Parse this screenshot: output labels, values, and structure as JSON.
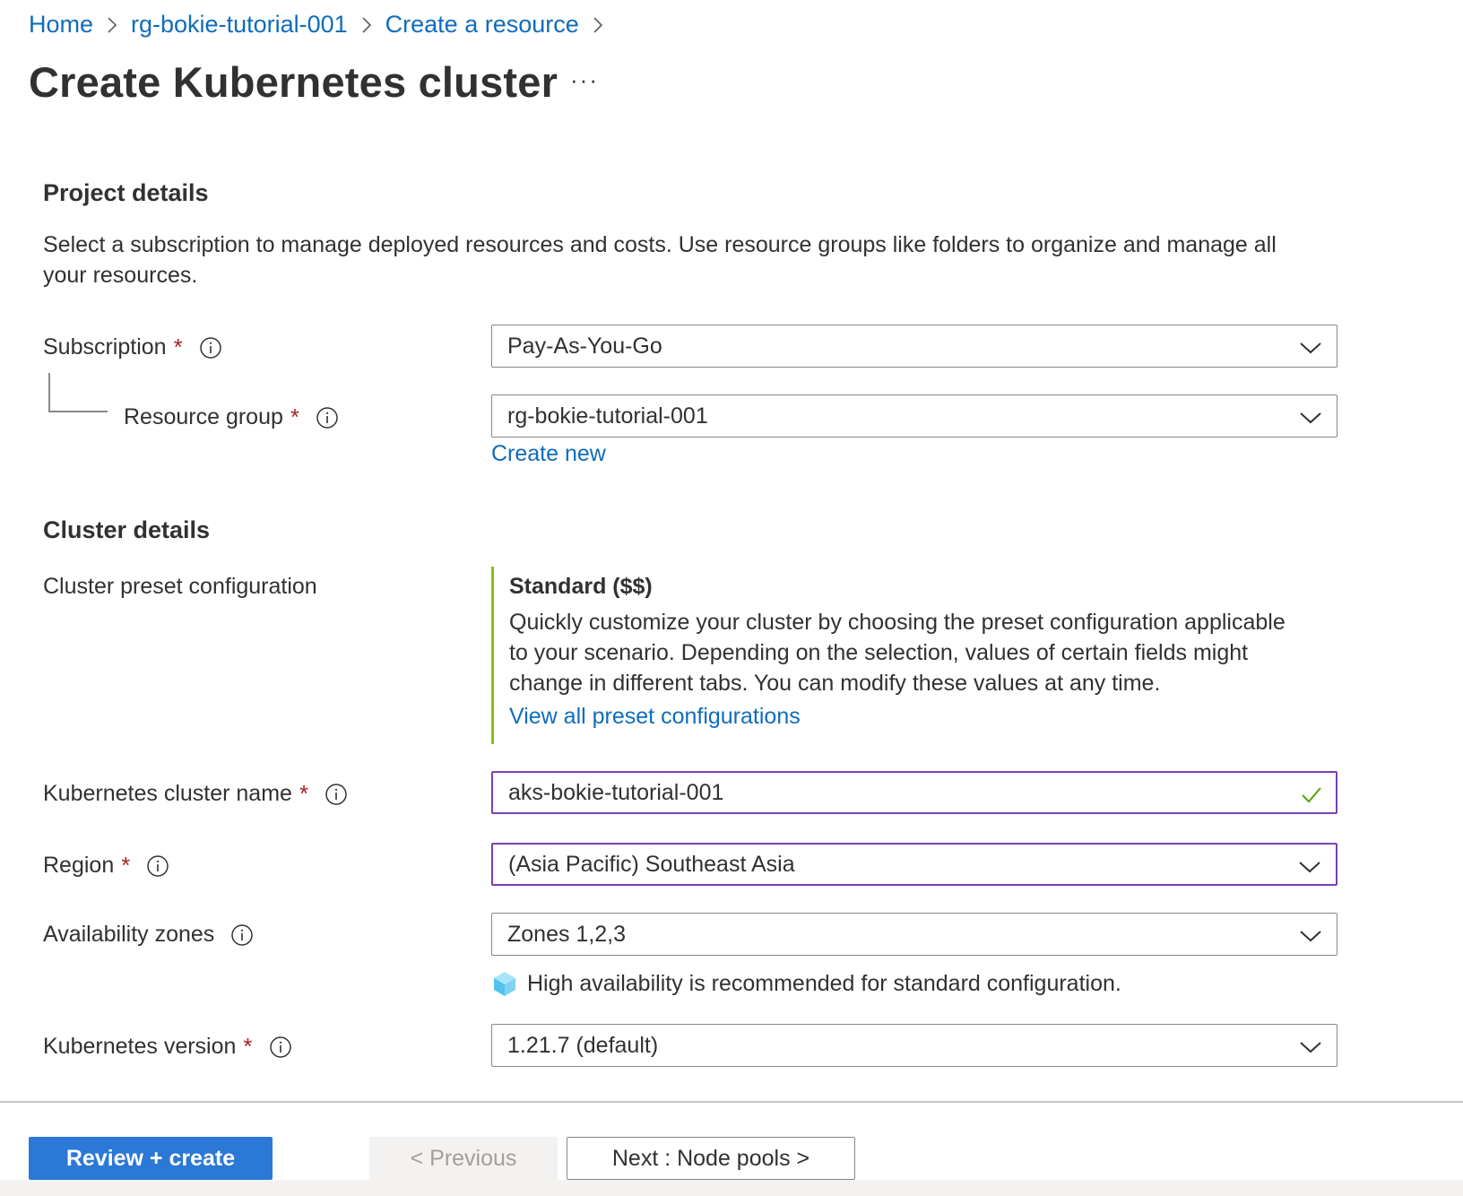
{
  "breadcrumb": {
    "items": [
      "Home",
      "rg-bokie-tutorial-001",
      "Create a resource"
    ]
  },
  "page": {
    "title": "Create Kubernetes cluster",
    "more": "···"
  },
  "project": {
    "title": "Project details",
    "description_line1": "Select a subscription to manage deployed resources and costs. Use resource groups like folders to organize and manage all",
    "description_line2": "your resources.",
    "subscription_label": "Subscription",
    "subscription_value": "Pay-As-You-Go",
    "resource_group_label": "Resource group",
    "resource_group_value": "rg-bokie-tutorial-001",
    "create_new": "Create new"
  },
  "cluster": {
    "title": "Cluster details",
    "preset_label": "Cluster preset configuration",
    "preset_title": "Standard ($$)",
    "preset_desc_line1": "Quickly customize your cluster by choosing the preset configuration applicable",
    "preset_desc_line2": "to your scenario. Depending on the selection, values of certain fields might",
    "preset_desc_line3": "change in different tabs. You can modify these values at any time.",
    "preset_link": "View all preset configurations",
    "name_label": "Kubernetes cluster name",
    "name_value": "aks-bokie-tutorial-001",
    "region_label": "Region",
    "region_value": "(Asia Pacific) Southeast Asia",
    "zones_label": "Availability zones",
    "zones_value": "Zones 1,2,3",
    "zones_note": "High availability is recommended for standard configuration.",
    "version_label": "Kubernetes version",
    "version_value": "1.21.7 (default)"
  },
  "required_marker": "*",
  "footer": {
    "review_create": "Review + create",
    "previous": "< Previous",
    "next": "Next : Node pools >"
  },
  "colors": {
    "link": "#0f6cbd",
    "primary_button": "#2b78d6",
    "required": "#a4262c",
    "focus_border": "#7b3fb5",
    "preset_accent": "#8cbd18",
    "success_check": "#57a300"
  }
}
